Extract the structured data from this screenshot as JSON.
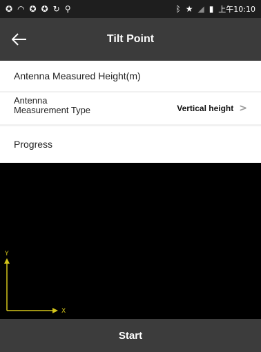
{
  "status_bar": {
    "left_icons": [
      "app-icon",
      "wifi-icon",
      "app-icon",
      "app-icon",
      "sync-icon",
      "location-pin-icon"
    ],
    "right_icons": [
      "bluetooth-icon",
      "star-icon",
      "signal-off-icon",
      "battery-icon"
    ],
    "time": "上午10:10"
  },
  "header": {
    "back_icon": "arrow-left-icon",
    "title": "Tilt Point"
  },
  "form": {
    "antenna_height_label": "Antenna Measured Height(m)",
    "measurement_type_label": "Antenna Measurement Type",
    "measurement_type_value": "Vertical height",
    "progress_label": "Progress"
  },
  "axes": {
    "x_label": "X",
    "y_label": "Y",
    "color": "#d4c51a"
  },
  "footer": {
    "start_label": "Start"
  }
}
